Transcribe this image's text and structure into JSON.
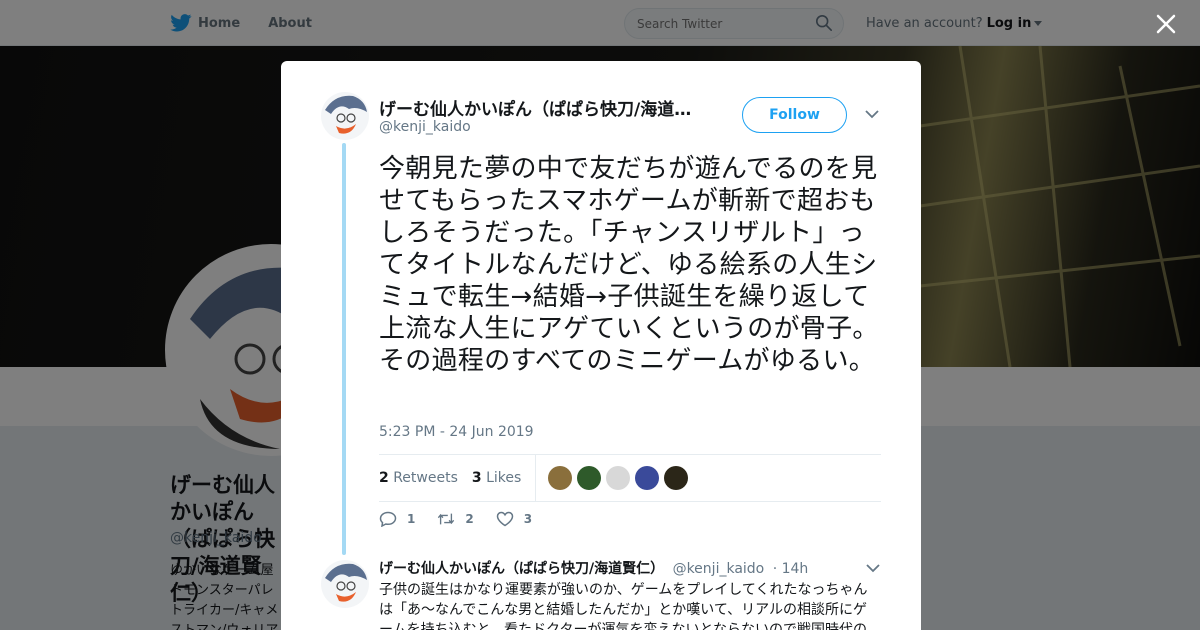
{
  "nav": {
    "home": "Home",
    "about": "About",
    "search_placeholder": "Search Twitter",
    "have_account": "Have an account?",
    "login": "Log in"
  },
  "profile_bg": {
    "name": "げーむ仙人かいぽん（ぱぱら快刀/海道賢仁）",
    "handle": "@kenji_kaido",
    "bio": "ゆかいなゲーム屋トモンスターパレトライカー/キャメストマン/ウォリアー"
  },
  "tweet": {
    "name": "げーむ仙人かいぽん（ぱぱら快刀/海道賢仁）",
    "handle": "@kenji_kaido",
    "follow": "Follow",
    "text": "今朝見た夢の中で友だちが遊んでるのを見せてもらったスマホゲームが斬新で超おもしろそうだった。「チャンスリザルト」ってタイトルなんだけど、ゆる絵系の人生シミュで転生→結婚→子供誕生を繰り返して上流な人生にアゲていくというのが骨子。その過程のすべてのミニゲームがゆるい。",
    "timestamp": "5:23 PM - 24 Jun 2019",
    "retweets_count": "2",
    "retweets_label": "Retweets",
    "likes_count": "3",
    "likes_label": "Likes",
    "reply_count": "1",
    "retweet_action_count": "2",
    "like_action_count": "3",
    "liker_colors": [
      "#8a6f3c",
      "#2e5a2a",
      "#d8d8d8",
      "#3a4a9a",
      "#2b2618"
    ]
  },
  "reply": {
    "name": "げーむ仙人かいぽん（ぱぱら快刀/海道賢仁）",
    "handle": "@kenji_kaido",
    "time": "· 14h",
    "text": "子供の誕生はかなり運要素が強いのか、ゲームをプレイしてくれたなっちゃんは「あ～なんでこんな男と結婚したんだか」とか嘆いて、リアルの相談所にゲームを持ち込むと、看たドクターが運気を変えないとならないので戦国時代の"
  },
  "colors": {
    "accent": "#1da1f2",
    "thread_line": "#a4d9f4",
    "muted": "#657786"
  }
}
